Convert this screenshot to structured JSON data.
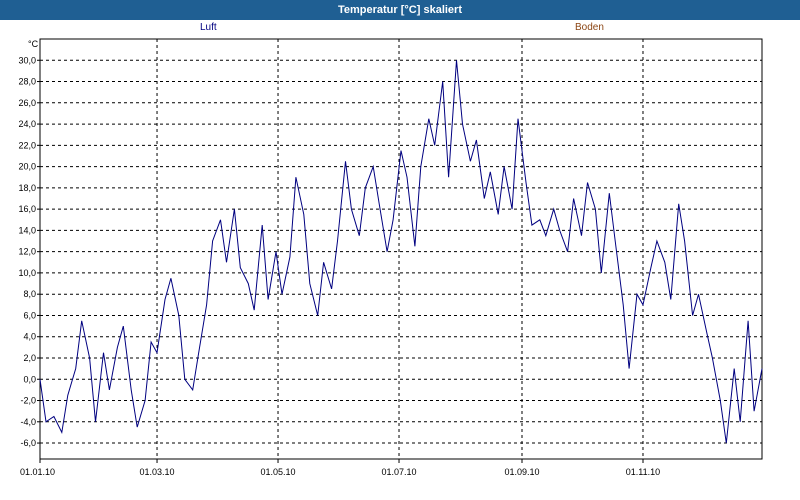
{
  "window": {
    "title": "Temperatur [°C] skaliert"
  },
  "chart_data": {
    "type": "line",
    "title": "Temperatur [°C] skaliert",
    "ylabel": "°C",
    "xlabel": "",
    "ylim": [
      -7.5,
      32.0
    ],
    "yticks": [
      -6.0,
      -4.0,
      -2.0,
      0.0,
      2.0,
      4.0,
      6.0,
      8.0,
      10.0,
      12.0,
      14.0,
      16.0,
      18.0,
      20.0,
      22.0,
      24.0,
      26.0,
      28.0,
      30.0
    ],
    "ytick_labels": [
      "-6,0",
      "-4,0",
      "-2,0",
      "0,0",
      "2,0",
      "4,0",
      "6,0",
      "8,0",
      "10,0",
      "12,0",
      "14,0",
      "16,0",
      "18,0",
      "20,0",
      "22,0",
      "24,0",
      "26,0",
      "28,0",
      "30,0"
    ],
    "xlim": [
      "2010-01-01",
      "2010-12-31"
    ],
    "xticks": [
      "2010-01-01",
      "2010-03-01",
      "2010-05-01",
      "2010-07-01",
      "2010-09-01",
      "2010-11-01"
    ],
    "xtick_labels": [
      "01.01.10",
      "01.03.10",
      "01.05.10",
      "01.07.10",
      "01.09.10",
      "01.11.10"
    ],
    "grid": true,
    "legend": [
      {
        "name": "Luft",
        "color": "#000080"
      },
      {
        "name": "Boden",
        "color": "#8b4513"
      }
    ],
    "series": [
      {
        "name": "Luft",
        "color": "#000080",
        "x": [
          "2010-01-01",
          "2010-01-04",
          "2010-01-08",
          "2010-01-12",
          "2010-01-15",
          "2010-01-19",
          "2010-01-22",
          "2010-01-26",
          "2010-01-29",
          "2010-02-02",
          "2010-02-05",
          "2010-02-09",
          "2010-02-12",
          "2010-02-16",
          "2010-02-19",
          "2010-02-23",
          "2010-02-26",
          "2010-03-01",
          "2010-03-05",
          "2010-03-08",
          "2010-03-12",
          "2010-03-15",
          "2010-03-19",
          "2010-03-22",
          "2010-03-26",
          "2010-03-29",
          "2010-04-02",
          "2010-04-05",
          "2010-04-09",
          "2010-04-12",
          "2010-04-16",
          "2010-04-19",
          "2010-04-23",
          "2010-04-26",
          "2010-04-30",
          "2010-05-03",
          "2010-05-07",
          "2010-05-10",
          "2010-05-14",
          "2010-05-17",
          "2010-05-21",
          "2010-05-24",
          "2010-05-28",
          "2010-05-31",
          "2010-06-04",
          "2010-06-07",
          "2010-06-11",
          "2010-06-14",
          "2010-06-18",
          "2010-06-21",
          "2010-06-25",
          "2010-06-28",
          "2010-07-02",
          "2010-07-05",
          "2010-07-09",
          "2010-07-12",
          "2010-07-16",
          "2010-07-19",
          "2010-07-23",
          "2010-07-26",
          "2010-07-30",
          "2010-08-02",
          "2010-08-06",
          "2010-08-09",
          "2010-08-13",
          "2010-08-16",
          "2010-08-20",
          "2010-08-23",
          "2010-08-27",
          "2010-08-30",
          "2010-09-03",
          "2010-09-06",
          "2010-09-10",
          "2010-09-13",
          "2010-09-17",
          "2010-09-20",
          "2010-09-24",
          "2010-09-27",
          "2010-10-01",
          "2010-10-04",
          "2010-10-08",
          "2010-10-11",
          "2010-10-15",
          "2010-10-18",
          "2010-10-22",
          "2010-10-25",
          "2010-10-29",
          "2010-11-01",
          "2010-11-05",
          "2010-11-08",
          "2010-11-12",
          "2010-11-15",
          "2010-11-19",
          "2010-11-22",
          "2010-11-26",
          "2010-11-29",
          "2010-12-03",
          "2010-12-06",
          "2010-12-10",
          "2010-12-13",
          "2010-12-17",
          "2010-12-20",
          "2010-12-24",
          "2010-12-27",
          "2010-12-31"
        ],
        "y": [
          0.0,
          -4.0,
          -3.5,
          -5.0,
          -1.5,
          1.0,
          5.5,
          2.0,
          -4.0,
          2.5,
          -1.0,
          3.0,
          5.0,
          -1.0,
          -4.5,
          -2.0,
          3.5,
          2.5,
          7.5,
          9.5,
          6.0,
          0.0,
          -1.0,
          2.5,
          7.0,
          13.0,
          15.0,
          11.0,
          16.0,
          10.5,
          9.0,
          6.5,
          14.5,
          7.5,
          12.0,
          8.0,
          11.5,
          19.0,
          15.5,
          9.0,
          6.0,
          11.0,
          8.5,
          13.0,
          20.5,
          16.0,
          13.5,
          18.0,
          20.0,
          16.5,
          12.0,
          15.0,
          21.5,
          19.0,
          12.5,
          20.0,
          24.5,
          22.0,
          28.0,
          19.0,
          30.0,
          24.0,
          20.5,
          22.5,
          17.0,
          19.5,
          15.5,
          20.0,
          16.0,
          24.5,
          18.5,
          14.5,
          15.0,
          13.5,
          16.0,
          14.0,
          12.0,
          17.0,
          13.5,
          18.5,
          16.0,
          10.0,
          17.5,
          13.0,
          7.0,
          1.0,
          8.0,
          7.0,
          10.5,
          13.0,
          11.0,
          7.5,
          16.5,
          13.0,
          6.0,
          8.0,
          4.5,
          2.0,
          -2.0,
          -6.0,
          1.0,
          -4.0,
          5.5,
          -3.0,
          1.0
        ]
      }
    ]
  }
}
